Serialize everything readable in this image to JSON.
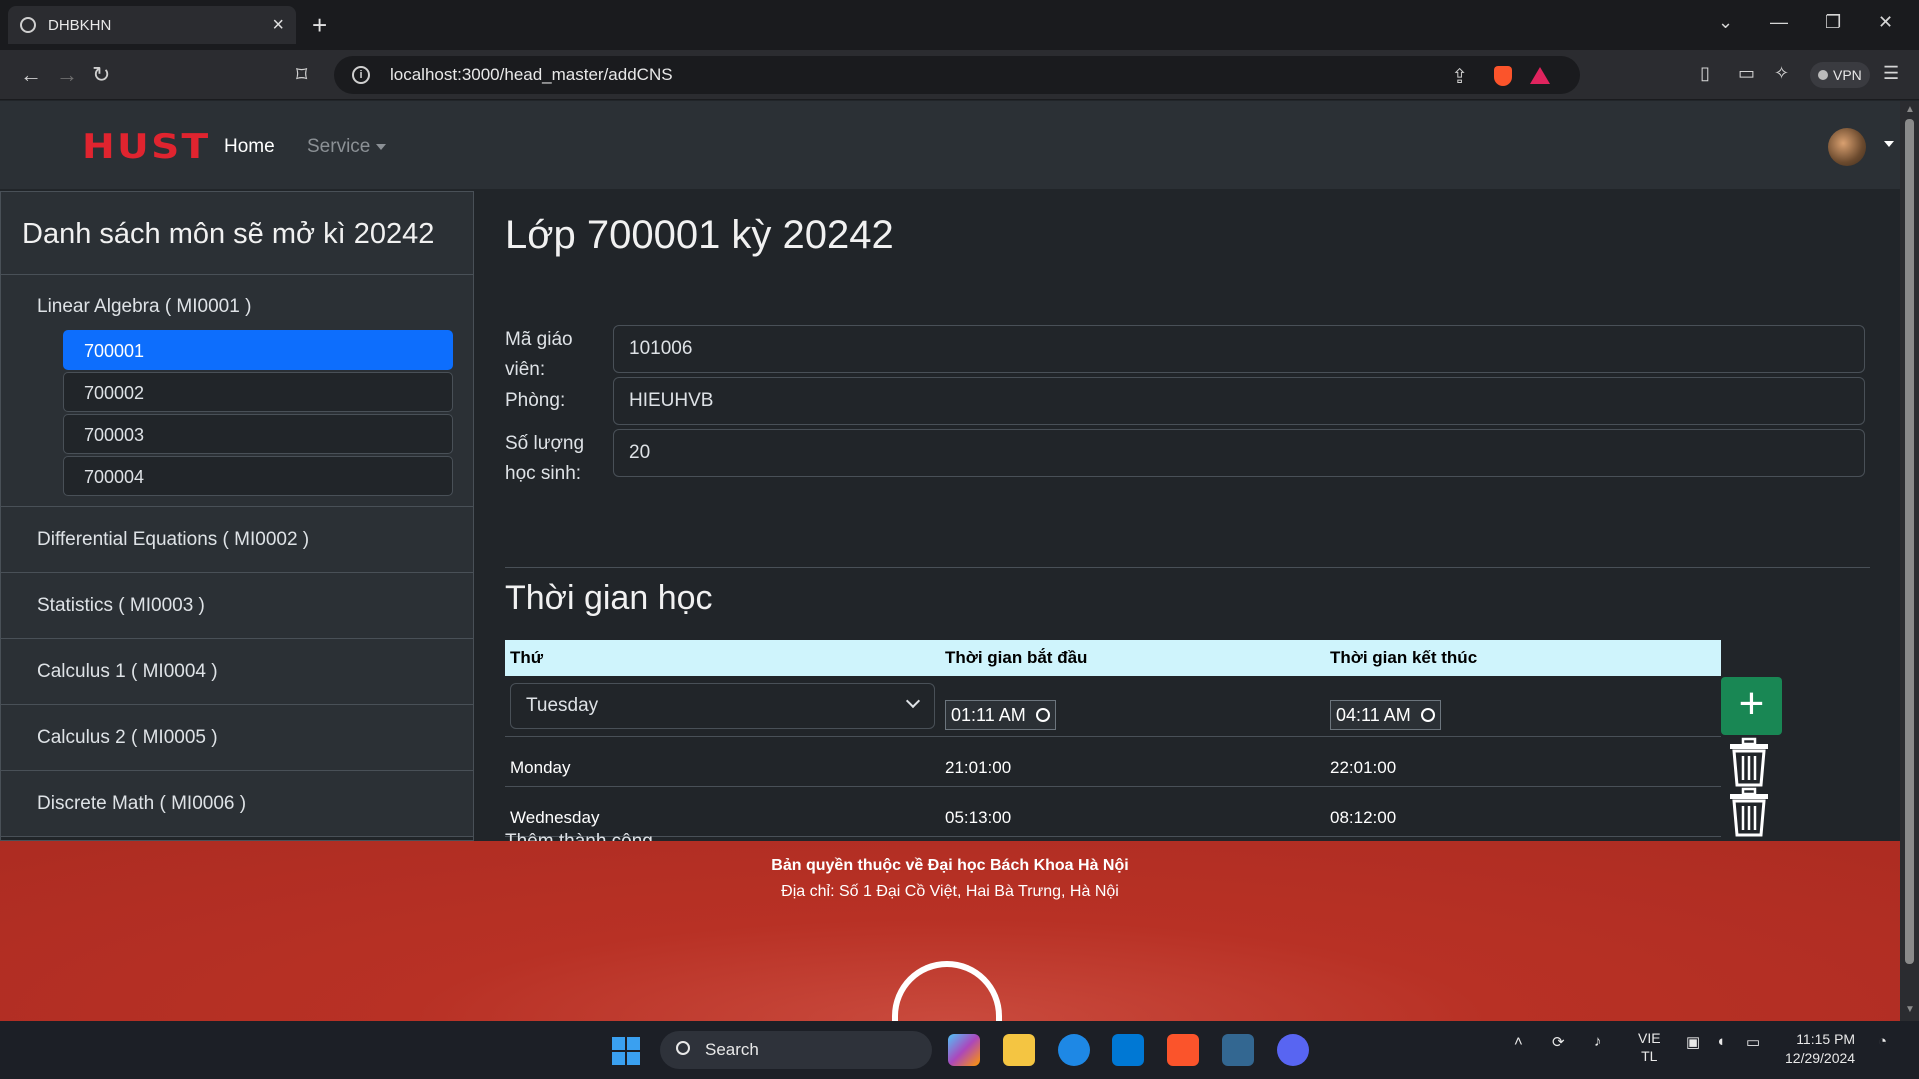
{
  "browser": {
    "tab_title": "DHBKHN",
    "url": "localhost:3000/head_master/addCNS",
    "vpn_label": "VPN"
  },
  "navbar": {
    "logo": "HUST",
    "home": "Home",
    "service": "Service"
  },
  "sidebar": {
    "title": "Danh sách môn sẽ mở kì 20242",
    "courses": [
      {
        "label": "Linear Algebra ( MI0001 )",
        "classes": [
          "700001",
          "700002",
          "700003",
          "700004"
        ]
      },
      {
        "label": "Differential Equations ( MI0002 )"
      },
      {
        "label": "Statistics ( MI0003 )"
      },
      {
        "label": "Calculus 1 ( MI0004 )"
      },
      {
        "label": "Calculus 2 ( MI0005 )"
      },
      {
        "label": "Discrete Math ( MI0006 )"
      }
    ]
  },
  "main": {
    "title": "Lớp 700001 kỳ 20242",
    "fields": [
      {
        "label": "Mã giáo viên:",
        "value": "101006"
      },
      {
        "label": "Phòng:",
        "value": "HIEUHVB"
      },
      {
        "label": "Số lượng học sinh:",
        "value": "20"
      }
    ],
    "schedule_title": "Thời gian học",
    "table": {
      "headers": [
        "Thứ",
        "Thời gian bắt đầu",
        "Thời gian kết thúc"
      ],
      "new_row": {
        "day": "Tuesday",
        "start": "01:11 AM",
        "end": "04:11 AM"
      },
      "rows": [
        {
          "day": "Monday",
          "start": "21:01:00",
          "end": "22:01:00"
        },
        {
          "day": "Wednesday",
          "start": "05:13:00",
          "end": "08:12:00"
        }
      ]
    },
    "status": "Thêm thành công"
  },
  "footer": {
    "line1": "Bản quyền thuộc về Đại học Bách Khoa Hà Nội",
    "line2": "Địa chỉ: Số 1 Đại Cồ Việt, Hai Bà Trưng, Hà Nội"
  },
  "taskbar": {
    "search": "Search",
    "lang1": "VIE",
    "lang2": "TL",
    "time": "11:15 PM",
    "date": "12/29/2024"
  }
}
